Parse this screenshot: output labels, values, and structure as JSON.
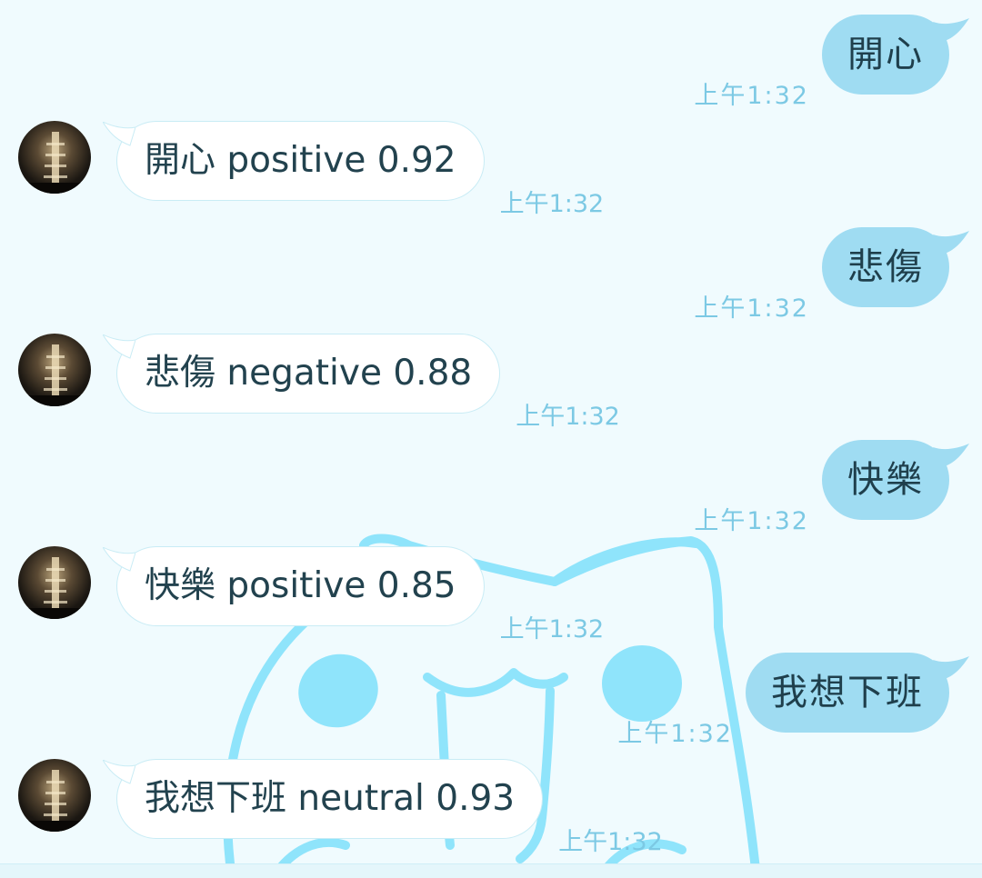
{
  "colors": {
    "background": "#f0fbfe",
    "outgoing_bubble": "#9fdcf2",
    "incoming_bubble": "#ffffff",
    "timestamp": "#7cc9e4",
    "wallpaper_line": "#8fe4fb"
  },
  "wallpaper": {
    "icon": "cat-face-icon"
  },
  "messages": [
    {
      "direction": "out",
      "text": "開心",
      "time": "上午1:32"
    },
    {
      "direction": "in",
      "text": "開心 positive 0.92",
      "time": "上午1:32",
      "avatar": "avatar-icon"
    },
    {
      "direction": "out",
      "text": "悲傷",
      "time": "上午1:32"
    },
    {
      "direction": "in",
      "text": "悲傷 negative 0.88",
      "time": "上午1:32",
      "avatar": "avatar-icon"
    },
    {
      "direction": "out",
      "text": "快樂",
      "time": "上午1:32"
    },
    {
      "direction": "in",
      "text": "快樂 positive 0.85",
      "time": "上午1:32",
      "avatar": "avatar-icon"
    },
    {
      "direction": "out",
      "text": "我想下班",
      "time": "上午1:32"
    },
    {
      "direction": "in",
      "text": "我想下班 neutral 0.93",
      "time": "上午1:32",
      "avatar": "avatar-icon"
    }
  ]
}
